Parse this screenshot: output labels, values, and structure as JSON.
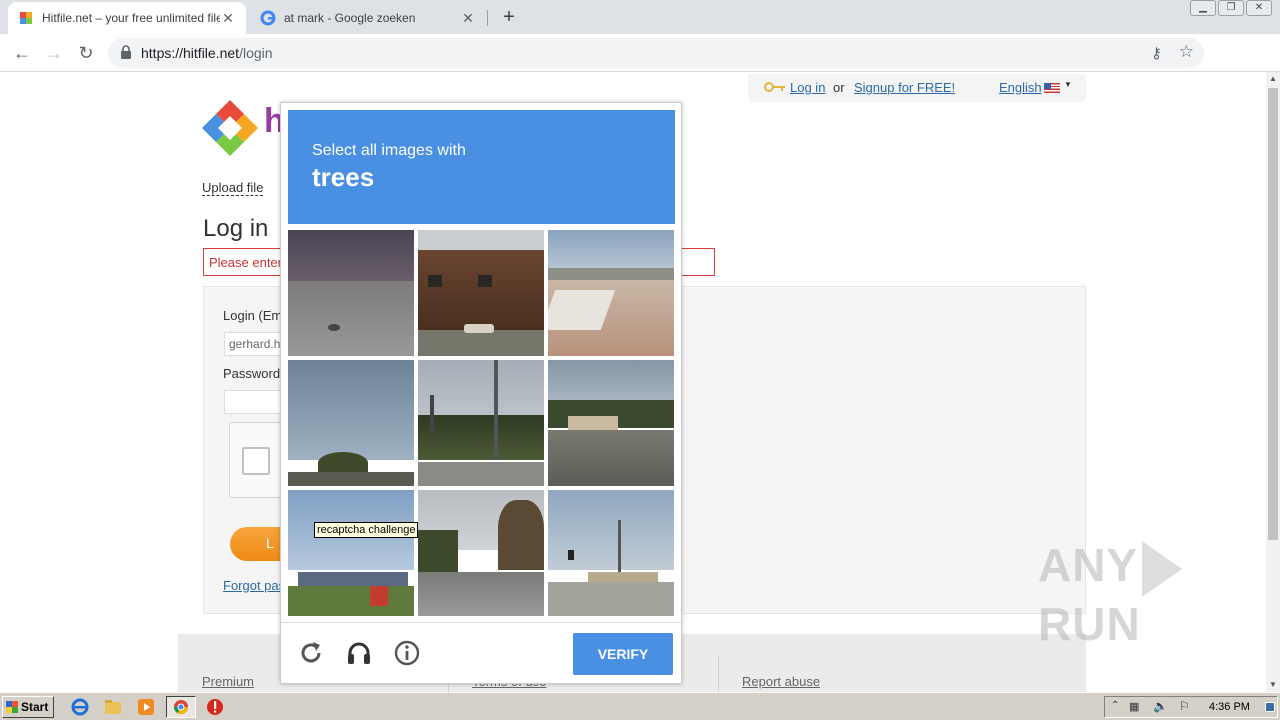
{
  "browser": {
    "tabs": [
      {
        "title": "Hitfile.net – your free unlimited file s",
        "active": true
      },
      {
        "title": "at mark - Google zoeken",
        "active": false
      }
    ],
    "url_host": "https://hitfile.net",
    "url_path": "/login"
  },
  "site": {
    "top_links": {
      "login": "Log in",
      "or": "or",
      "signup": "Signup for FREE!",
      "language": "English"
    },
    "logo_letter": "h",
    "upload_link": "Upload file",
    "page_title": "Log in",
    "error_text": "Please enter",
    "login_label": "Login (Em",
    "email_value": "gerhard.h",
    "password_label": "Password",
    "login_button": "L",
    "forgot_link": "Forgot pas",
    "footer": {
      "premium": "Premium",
      "terms": "Terms of use",
      "report": "Report abuse"
    }
  },
  "captcha": {
    "desc": "Select all images with",
    "target": "trees",
    "tooltip": "recaptcha challenge",
    "verify_label": "VERIFY",
    "icons": [
      "reload-icon",
      "audio-icon",
      "info-icon"
    ]
  },
  "watermark": {
    "left": "ANY",
    "right": "RUN"
  },
  "taskbar": {
    "start_label": "Start",
    "clock": "4:36 PM"
  },
  "colors": {
    "captcha_blue": "#4a90e2",
    "error_red": "#d93d3d",
    "link_blue": "#2a6aa8",
    "button_orange": "#ee8b14"
  }
}
